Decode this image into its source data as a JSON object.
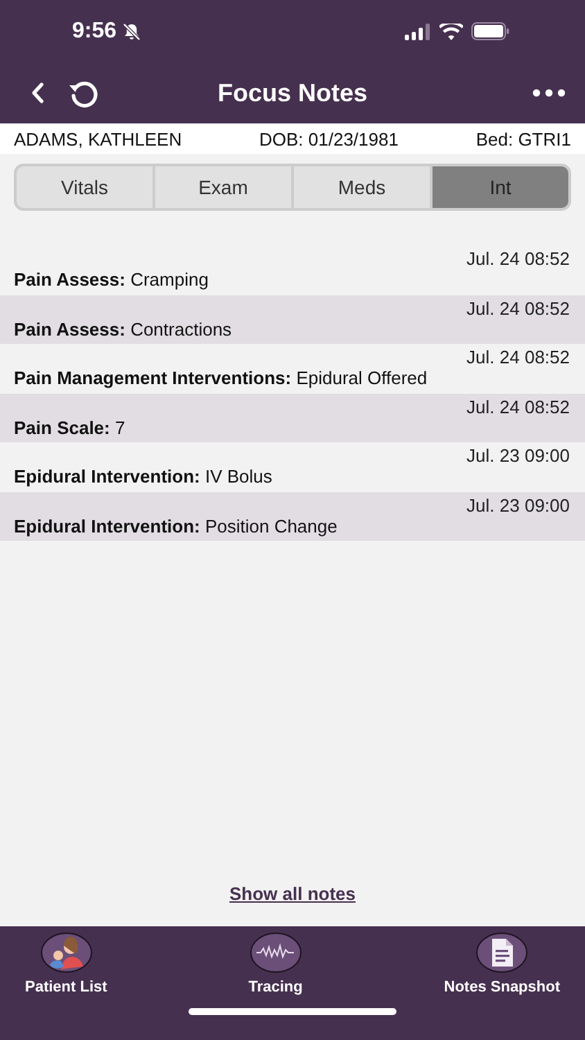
{
  "status_bar": {
    "time": "9:56"
  },
  "nav": {
    "title": "Focus Notes"
  },
  "patient": {
    "name": "ADAMS, KATHLEEN",
    "dob": "DOB: 01/23/1981",
    "bed": "Bed: GTRI1"
  },
  "tabs": [
    {
      "label": "Vitals",
      "selected": false
    },
    {
      "label": "Exam",
      "selected": false
    },
    {
      "label": "Meds",
      "selected": false
    },
    {
      "label": "Int",
      "selected": true
    }
  ],
  "notes": [
    {
      "time": "Jul. 24 08:52",
      "text": "**Pain Assess:** Cramping"
    },
    {
      "time": "Jul. 24 08:52",
      "text": "**Pain Assess:** Contractions"
    },
    {
      "time": "Jul. 24 08:52",
      "text": "**Pain Management Interventions:** Epidural Offered"
    },
    {
      "time": "Jul. 24 08:52",
      "text": "**Pain Scale:** 7"
    },
    {
      "time": "Jul. 23 09:00",
      "text": "**Epidural Intervention:** IV Bolus"
    },
    {
      "time": "Jul. 23 09:00",
      "text": "**Epidural Intervention:** Position Change"
    }
  ],
  "show_all_link": "Show all notes",
  "bottom_nav": [
    {
      "kind": "patients",
      "label": "Patient List"
    },
    {
      "kind": "tracing",
      "label": "Tracing"
    },
    {
      "kind": "snapshot",
      "label": "Notes Snapshot"
    }
  ]
}
